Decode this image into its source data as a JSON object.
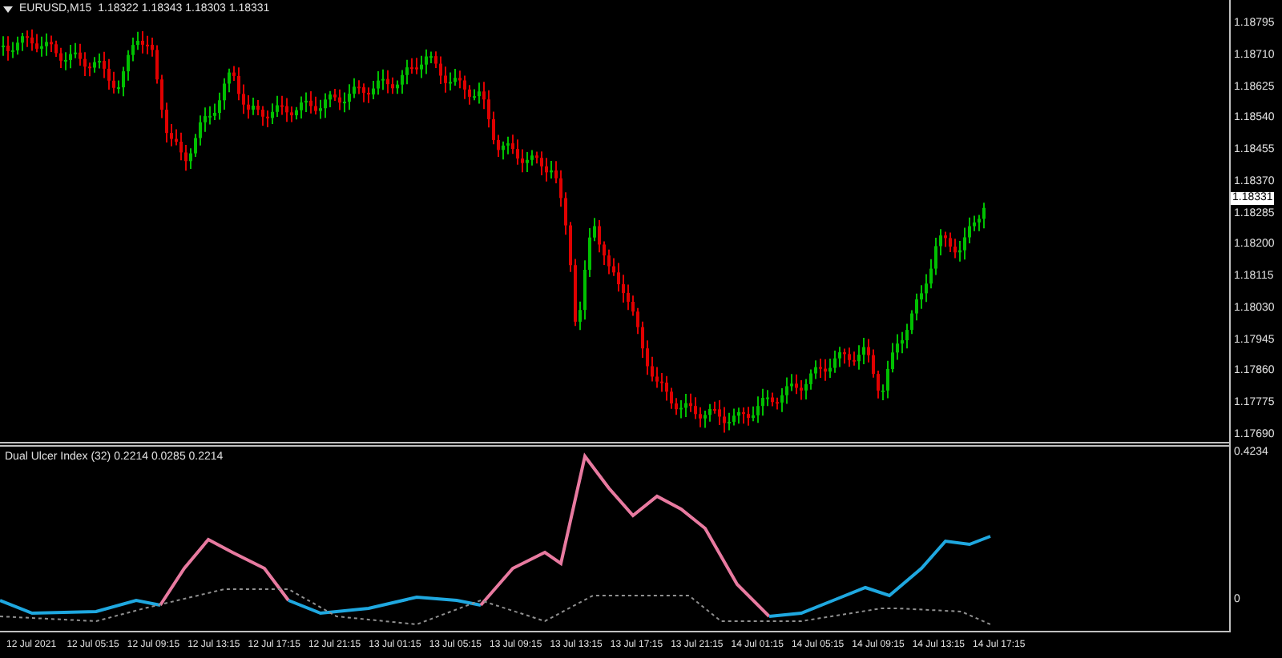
{
  "symbol_bar": {
    "symbol": "EURUSD,M15",
    "quotes": "1.18322 1.18343 1.18303 1.18331"
  },
  "price_axis": {
    "labels": [
      "1.18795",
      "1.18710",
      "1.18625",
      "1.18540",
      "1.18455",
      "1.18370",
      "1.18285",
      "1.18200",
      "1.18115",
      "1.18030",
      "1.17945",
      "1.17860",
      "1.17775",
      "1.17690"
    ],
    "current_price": "1.18331"
  },
  "indicator": {
    "label": "Dual Ulcer Index (32) 0.2214 0.0285 0.2214",
    "axis_max": "0.4234",
    "axis_min": "0"
  },
  "time_axis": [
    "12 Jul 2021",
    "12 Jul 05:15",
    "12 Jul 09:15",
    "12 Jul 13:15",
    "12 Jul 17:15",
    "12 Jul 21:15",
    "13 Jul 01:15",
    "13 Jul 05:15",
    "13 Jul 09:15",
    "13 Jul 13:15",
    "13 Jul 17:15",
    "13 Jul 21:15",
    "14 Jul 01:15",
    "14 Jul 05:15",
    "14 Jul 09:15",
    "14 Jul 13:15",
    "14 Jul 17:15"
  ]
}
